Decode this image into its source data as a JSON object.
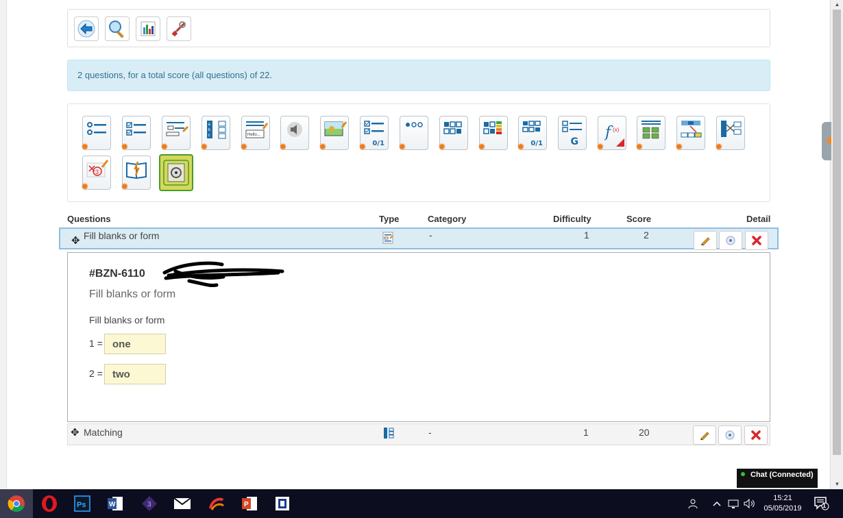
{
  "toolbar": {
    "buttons": [
      {
        "name": "back",
        "icon": "back-arrow-icon"
      },
      {
        "name": "preview",
        "icon": "magnifier-icon"
      },
      {
        "name": "statistics",
        "icon": "bar-chart-icon"
      },
      {
        "name": "settings",
        "icon": "tools-icon"
      }
    ]
  },
  "info": {
    "text": "2 questions, for a total score (all questions) of 22."
  },
  "question_types": {
    "subs": {
      "t8": "0/1",
      "t14": "0/1",
      "t15": "G"
    },
    "labels": {
      "t5": "Hello..."
    }
  },
  "table": {
    "headers": {
      "questions": "Questions",
      "type": "Type",
      "category": "Category",
      "difficulty": "Difficulty",
      "score": "Score",
      "detail": "Detail"
    },
    "rows": [
      {
        "title": "Fill blanks or form",
        "category": "-",
        "difficulty": "1",
        "score": "2"
      },
      {
        "title": "Matching",
        "category": "-",
        "difficulty": "1",
        "score": "20"
      }
    ]
  },
  "detail": {
    "id": "#BZN-6110",
    "name": "Fill blanks or form",
    "statement": "Fill blanks or form",
    "answers": [
      {
        "label": "1 =",
        "value": "one"
      },
      {
        "label": "2 =",
        "value": "two"
      }
    ]
  },
  "chat": {
    "label": "Chat (Connected)",
    "status_color": "#3cbb3c"
  },
  "taskbar": {
    "time": "15:21",
    "date": "05/05/2019",
    "notification_count": "1",
    "apps": [
      "chrome",
      "opera",
      "photoshop",
      "word",
      "visual-studio",
      "mail",
      "ccleaner",
      "powerpoint",
      "app"
    ]
  },
  "colors": {
    "info_bg": "#d9edf7",
    "info_text": "#31708f",
    "row_highlight": "#dcecf5",
    "answer_bg": "#fcf8d4",
    "delete_red": "#d9262a"
  }
}
